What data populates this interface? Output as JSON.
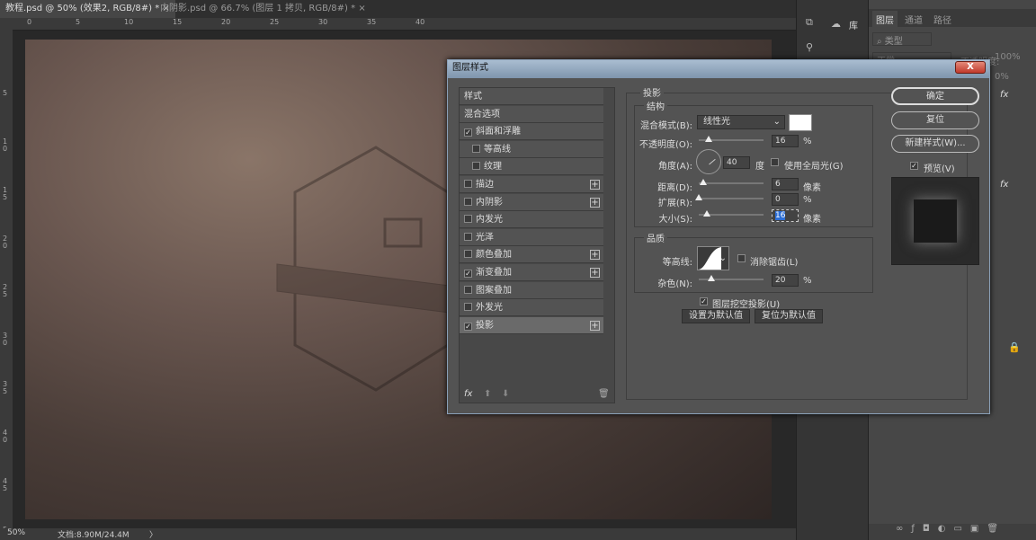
{
  "tabs": [
    {
      "label": "教程.psd @ 50% (效果2, RGB/8#) *",
      "close": "×"
    },
    {
      "label": "内阴影.psd @ 66.7% (图层 1 拷贝, RGB/8#) *",
      "close": "×"
    }
  ],
  "ruler": {
    "h": [
      "0",
      "5",
      "10",
      "15",
      "20",
      "25",
      "30",
      "35",
      "40"
    ],
    "v": [
      "5",
      "1\n0",
      "1\n5",
      "2\n0",
      "2\n5",
      "3\n0",
      "3\n5",
      "4\n0",
      "4\n5",
      "5"
    ]
  },
  "status": {
    "zoom": "50%",
    "doc": "文档:8.90M/24.4M",
    "arrow": "〉"
  },
  "columns": {
    "library": "库"
  },
  "layers_panel": {
    "tabs": [
      "图层",
      "通道",
      "路径"
    ],
    "filter": "类型",
    "blend": "正常",
    "opacity_label": "不透明度:",
    "opacity": "100%",
    "fill": "0%",
    "fx": "fx"
  },
  "dialog": {
    "title": "图层样式",
    "close": "X",
    "styles": [
      {
        "label": "样式",
        "check": null,
        "plus": false,
        "indent": false
      },
      {
        "label": "混合选项",
        "check": null,
        "plus": false,
        "indent": false
      },
      {
        "label": "斜面和浮雕",
        "check": true,
        "plus": false,
        "indent": false
      },
      {
        "label": "等高线",
        "check": false,
        "plus": false,
        "indent": true
      },
      {
        "label": "纹理",
        "check": false,
        "plus": false,
        "indent": true
      },
      {
        "label": "描边",
        "check": false,
        "plus": true,
        "indent": false
      },
      {
        "label": "内阴影",
        "check": false,
        "plus": true,
        "indent": false
      },
      {
        "label": "内发光",
        "check": false,
        "plus": false,
        "indent": false
      },
      {
        "label": "光泽",
        "check": false,
        "plus": false,
        "indent": false
      },
      {
        "label": "颜色叠加",
        "check": false,
        "plus": true,
        "indent": false
      },
      {
        "label": "渐变叠加",
        "check": true,
        "plus": true,
        "indent": false
      },
      {
        "label": "图案叠加",
        "check": false,
        "plus": false,
        "indent": false
      },
      {
        "label": "外发光",
        "check": false,
        "plus": false,
        "indent": false
      },
      {
        "label": "投影",
        "check": true,
        "plus": true,
        "indent": false,
        "selected": true
      }
    ],
    "section": "投影",
    "structure": "结构",
    "blend_mode_label": "混合模式(B):",
    "blend_mode": "线性光",
    "shadow_color": "#ffffff",
    "opacity_label": "不透明度(O):",
    "opacity": "16",
    "pct": "%",
    "angle_label": "角度(A):",
    "angle": "40",
    "deg": "度",
    "global_light": "使用全局光(G)",
    "distance_label": "距离(D):",
    "distance": "6",
    "px": "像素",
    "spread_label": "扩展(R):",
    "spread": "0",
    "size_label": "大小(S):",
    "size": "16",
    "quality": "品质",
    "contour_label": "等高线:",
    "antialias": "消除锯齿(L)",
    "noise_label": "杂色(N):",
    "noise": "20",
    "knockout": "图层挖空投影(U)",
    "make_default": "设置为默认值",
    "reset_default": "复位为默认值",
    "ok": "确定",
    "reset": "复位",
    "new_style": "新建样式(W)...",
    "preview": "预览(V)"
  }
}
